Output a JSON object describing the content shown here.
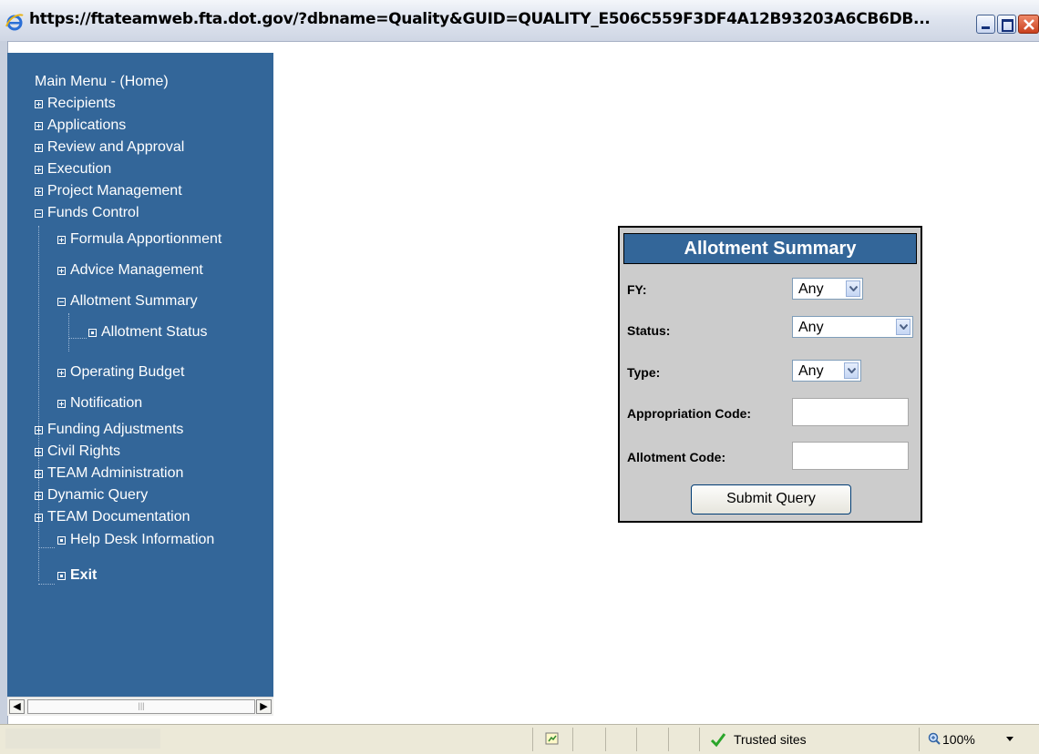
{
  "window": {
    "title": "https://ftateamweb.fta.dot.gov/?dbname=Quality&GUID=QUALITY_E506C559F3DF4A12B93203A6CB6DB..."
  },
  "sidebar": {
    "main_menu": "Main Menu - (Home)",
    "items": [
      {
        "label": "Recipients",
        "state": "collapsed"
      },
      {
        "label": "Applications",
        "state": "collapsed"
      },
      {
        "label": "Review and Approval",
        "state": "collapsed"
      },
      {
        "label": "Execution",
        "state": "collapsed"
      },
      {
        "label": "Project Management",
        "state": "collapsed"
      },
      {
        "label": "Funds Control",
        "state": "expanded"
      }
    ],
    "funds_children": [
      {
        "label": "Formula Apportionment",
        "state": "collapsed"
      },
      {
        "label": "Advice Management",
        "state": "collapsed"
      },
      {
        "label": "Allotment Summary",
        "state": "expanded"
      },
      {
        "label": "Allotment Status",
        "state": "leaf"
      },
      {
        "label": "Operating Budget",
        "state": "collapsed"
      },
      {
        "label": "Notification",
        "state": "collapsed"
      }
    ],
    "items_after": [
      {
        "label": "Funding Adjustments",
        "state": "collapsed"
      },
      {
        "label": "Civil Rights",
        "state": "collapsed"
      },
      {
        "label": "TEAM Administration",
        "state": "collapsed"
      },
      {
        "label": "Dynamic Query",
        "state": "collapsed"
      },
      {
        "label": "TEAM Documentation",
        "state": "collapsed"
      },
      {
        "label": "Help Desk Information",
        "state": "leaf"
      },
      {
        "label": "Exit",
        "state": "leaf"
      }
    ]
  },
  "form": {
    "title": "Allotment Summary",
    "fy_label": "FY:",
    "fy_value": "Any",
    "status_label": "Status:",
    "status_value": "Any",
    "type_label": "Type:",
    "type_value": "Any",
    "appropriation_label": "Appropriation Code:",
    "appropriation_value": "",
    "allotment_label": "Allotment Code:",
    "allotment_value": "",
    "submit_label": "Submit Query"
  },
  "statusbar": {
    "zone": "Trusted sites",
    "zoom": "100%"
  },
  "colors": {
    "sidebar_bg": "#336699",
    "panel_bg": "#cccccc",
    "panel_header": "#336699"
  }
}
